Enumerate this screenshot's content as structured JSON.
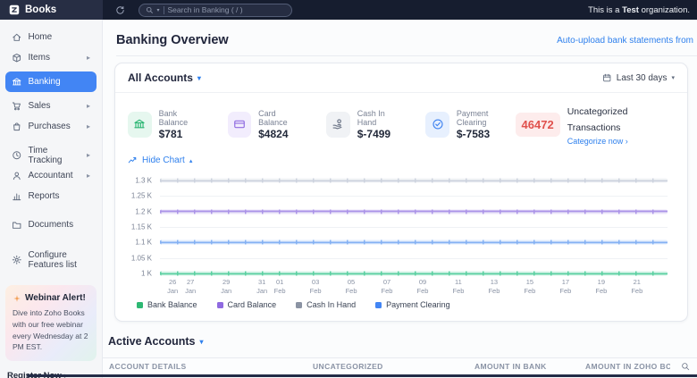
{
  "glyphs": {
    "caret_down": "▾",
    "caret_up": "▴",
    "tri_right": "▸"
  },
  "topbar": {
    "logo_text": "Books",
    "search_placeholder": "Search in Banking ( / )",
    "org_prefix": "This is a ",
    "org_bold": "Test",
    "org_suffix": " organization."
  },
  "sidebar": {
    "items": [
      {
        "label": "Home",
        "icon": "home-icon",
        "has_arrow": false,
        "active": false
      },
      {
        "label": "Items",
        "icon": "items-icon",
        "has_arrow": true,
        "active": false
      },
      {
        "label": "Banking",
        "icon": "banking-icon",
        "has_arrow": false,
        "active": true
      },
      {
        "label": "Sales",
        "icon": "sales-icon",
        "has_arrow": true,
        "active": false
      },
      {
        "label": "Purchases",
        "icon": "purchases-icon",
        "has_arrow": true,
        "active": false
      },
      {
        "label": "Time Tracking",
        "icon": "time-icon",
        "has_arrow": true,
        "active": false
      },
      {
        "label": "Accountant",
        "icon": "accountant-icon",
        "has_arrow": true,
        "active": false
      },
      {
        "label": "Reports",
        "icon": "reports-icon",
        "has_arrow": false,
        "active": false
      },
      {
        "label": "Documents",
        "icon": "documents-icon",
        "has_arrow": false,
        "active": false
      },
      {
        "label": "Configure Features list",
        "icon": "gear-icon",
        "has_arrow": false,
        "active": false
      }
    ],
    "webinar": {
      "title": "Webinar Alert!",
      "body": "Dive into Zoho Books with our free webinar every Wednesday at 2 PM EST.",
      "register_label": "Register Now ›"
    }
  },
  "header": {
    "title": "Banking Overview",
    "auto_upload_link": "Auto-upload bank statements from"
  },
  "panel": {
    "accounts_filter": "All Accounts",
    "date_range": "Last 30 days",
    "summary": [
      {
        "label": "Bank Balance",
        "value": "$781",
        "icon": "bank-icon",
        "color": "#2bb673",
        "bg": "#e6f7ef"
      },
      {
        "label": "Card Balance",
        "value": "$4824",
        "icon": "card-icon",
        "color": "#8f6ae0",
        "bg": "#f2edfd"
      },
      {
        "label": "Cash In Hand",
        "value": "$-7499",
        "icon": "cash-icon",
        "color": "#6b7486",
        "bg": "#f0f2f5"
      },
      {
        "label": "Payment Clearing",
        "value": "$-7583",
        "icon": "check-circle-icon",
        "color": "#3f82f0",
        "bg": "#e7f0fe"
      }
    ],
    "uncategorized": {
      "count": "46472",
      "label": "Uncategorized Transactions",
      "action": "Categorize now ›"
    },
    "hide_chart_label": "Hide Chart"
  },
  "chart_data": {
    "type": "line",
    "title": "",
    "x": [
      "26 Jan",
      "27 Jan",
      "29 Jan",
      "31 Jan",
      "01 Feb",
      "03 Feb",
      "05 Feb",
      "07 Feb",
      "09 Feb",
      "11 Feb",
      "13 Feb",
      "15 Feb",
      "17 Feb",
      "19 Feb",
      "21 Feb"
    ],
    "day_offsets": [
      0,
      1,
      3,
      5,
      6,
      8,
      10,
      12,
      14,
      16,
      18,
      20,
      22,
      24,
      26
    ],
    "y_ticks": [
      "1.3 K",
      "1.25 K",
      "1.2 K",
      "1.15 K",
      "1.1 K",
      "1.05 K",
      "1 K"
    ],
    "ylim_k": [
      1.0,
      1.3
    ],
    "grid": true,
    "legend_position": "bottom",
    "series": [
      {
        "name": "Bank Balance",
        "value_k": 1.0,
        "values_note": "flat line at 1 K across all dates",
        "line_color": "#5bd0a1",
        "swatch_color": "#2eb873"
      },
      {
        "name": "Card Balance",
        "value_k": 1.2,
        "values_note": "flat line at 1.2 K across all dates",
        "line_color": "#ab93e8",
        "swatch_color": "#8f6ae0"
      },
      {
        "name": "Cash In Hand",
        "value_k": 1.3,
        "values_note": "flat line at 1.3 K across all dates",
        "line_color": "#ccd2de",
        "swatch_color": "#8b93a3"
      },
      {
        "name": "Payment Clearing",
        "value_k": 1.1,
        "values_note": "flat line at 1.1 K across all dates",
        "line_color": "#84b1f3",
        "swatch_color": "#4285f4"
      }
    ]
  },
  "active_accounts": {
    "title": "Active Accounts",
    "columns": [
      "ACCOUNT DETAILS",
      "UNCATEGORIZED",
      "AMOUNT IN BANK",
      "AMOUNT IN ZOHO BOOKS"
    ]
  }
}
